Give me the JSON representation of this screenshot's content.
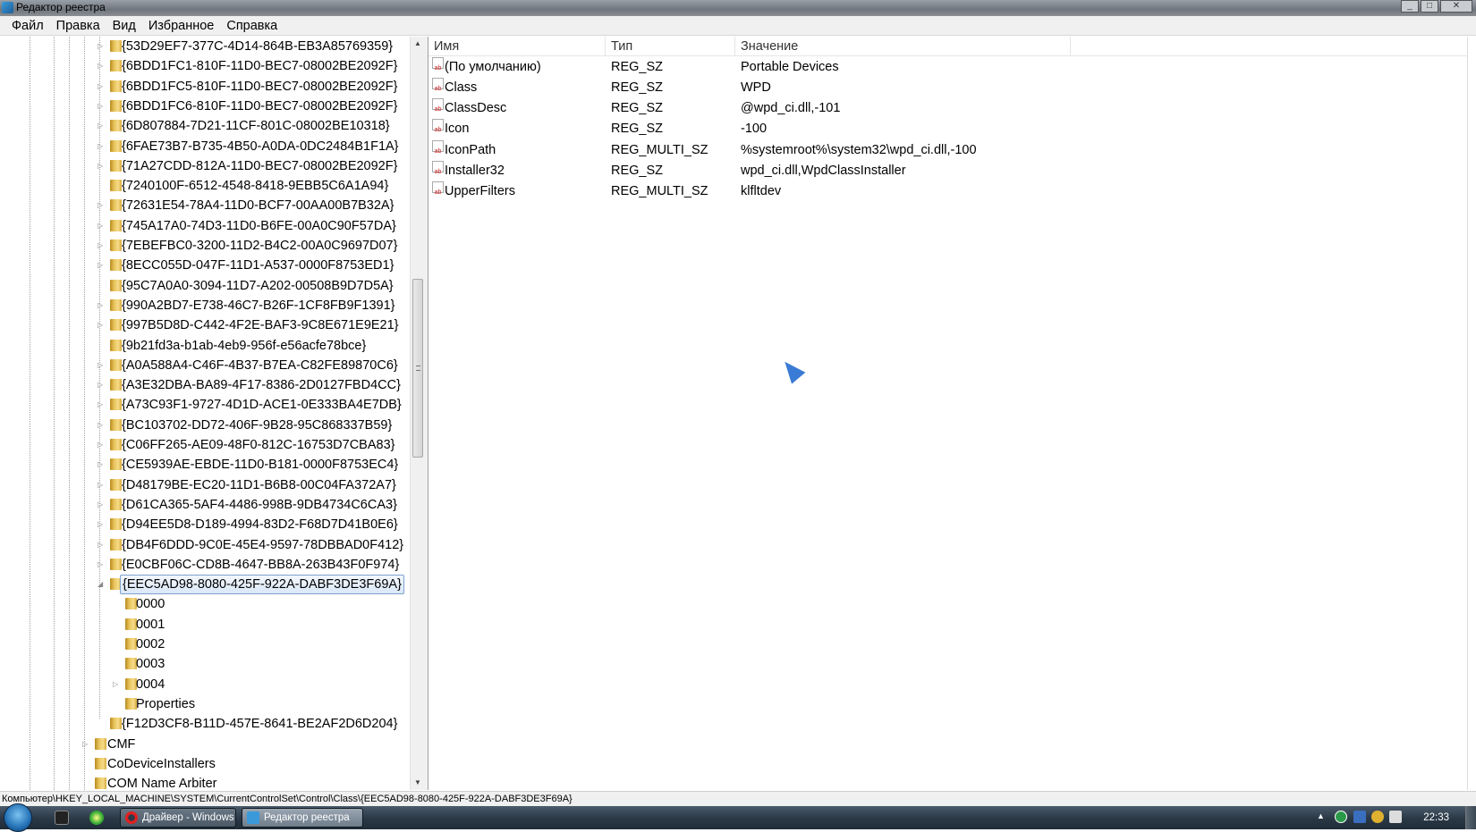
{
  "window": {
    "title": "Редактор реестра"
  },
  "menu": [
    "Файл",
    "Правка",
    "Вид",
    "Избранное",
    "Справка"
  ],
  "tree": [
    {
      "label": "{53D29EF7-377C-4D14-864B-EB3A85769359}",
      "level": 2,
      "expander": "closed"
    },
    {
      "label": "{6BDD1FC1-810F-11D0-BEC7-08002BE2092F}",
      "level": 2,
      "expander": "closed"
    },
    {
      "label": "{6BDD1FC5-810F-11D0-BEC7-08002BE2092F}",
      "level": 2,
      "expander": "closed"
    },
    {
      "label": "{6BDD1FC6-810F-11D0-BEC7-08002BE2092F}",
      "level": 2,
      "expander": "closed"
    },
    {
      "label": "{6D807884-7D21-11CF-801C-08002BE10318}",
      "level": 2,
      "expander": "closed"
    },
    {
      "label": "{6FAE73B7-B735-4B50-A0DA-0DC2484B1F1A}",
      "level": 2,
      "expander": "closed"
    },
    {
      "label": "{71A27CDD-812A-11D0-BEC7-08002BE2092F}",
      "level": 2,
      "expander": "closed"
    },
    {
      "label": "{7240100F-6512-4548-8418-9EBB5C6A1A94}",
      "level": 2,
      "expander": "none"
    },
    {
      "label": "{72631E54-78A4-11D0-BCF7-00AA00B7B32A}",
      "level": 2,
      "expander": "closed"
    },
    {
      "label": "{745A17A0-74D3-11D0-B6FE-00A0C90F57DA}",
      "level": 2,
      "expander": "closed"
    },
    {
      "label": "{7EBEFBC0-3200-11D2-B4C2-00A0C9697D07}",
      "level": 2,
      "expander": "closed"
    },
    {
      "label": "{8ECC055D-047F-11D1-A537-0000F8753ED1}",
      "level": 2,
      "expander": "closed"
    },
    {
      "label": "{95C7A0A0-3094-11D7-A202-00508B9D7D5A}",
      "level": 2,
      "expander": "none"
    },
    {
      "label": "{990A2BD7-E738-46C7-B26F-1CF8FB9F1391}",
      "level": 2,
      "expander": "closed"
    },
    {
      "label": "{997B5D8D-C442-4F2E-BAF3-9C8E671E9E21}",
      "level": 2,
      "expander": "closed"
    },
    {
      "label": "{9b21fd3a-b1ab-4eb9-956f-e56acfe78bce}",
      "level": 2,
      "expander": "none"
    },
    {
      "label": "{A0A588A4-C46F-4B37-B7EA-C82FE89870C6}",
      "level": 2,
      "expander": "closed"
    },
    {
      "label": "{A3E32DBA-BA89-4F17-8386-2D0127FBD4CC}",
      "level": 2,
      "expander": "closed"
    },
    {
      "label": "{A73C93F1-9727-4D1D-ACE1-0E333BA4E7DB}",
      "level": 2,
      "expander": "closed"
    },
    {
      "label": "{BC103702-DD72-406F-9B28-95C868337B59}",
      "level": 2,
      "expander": "closed"
    },
    {
      "label": "{C06FF265-AE09-48F0-812C-16753D7CBA83}",
      "level": 2,
      "expander": "closed"
    },
    {
      "label": "{CE5939AE-EBDE-11D0-B181-0000F8753EC4}",
      "level": 2,
      "expander": "closed"
    },
    {
      "label": "{D48179BE-EC20-11D1-B6B8-00C04FA372A7}",
      "level": 2,
      "expander": "closed"
    },
    {
      "label": "{D61CA365-5AF4-4486-998B-9DB4734C6CA3}",
      "level": 2,
      "expander": "closed"
    },
    {
      "label": "{D94EE5D8-D189-4994-83D2-F68D7D41B0E6}",
      "level": 2,
      "expander": "closed"
    },
    {
      "label": "{DB4F6DDD-9C0E-45E4-9597-78DBBAD0F412}",
      "level": 2,
      "expander": "closed"
    },
    {
      "label": "{E0CBF06C-CD8B-4647-BB8A-263B43F0F974}",
      "level": 2,
      "expander": "closed"
    },
    {
      "label": "{EEC5AD98-8080-425F-922A-DABF3DE3F69A}",
      "level": 2,
      "expander": "open",
      "selected": true
    },
    {
      "label": "0000",
      "level": 3,
      "expander": "none"
    },
    {
      "label": "0001",
      "level": 3,
      "expander": "none"
    },
    {
      "label": "0002",
      "level": 3,
      "expander": "none"
    },
    {
      "label": "0003",
      "level": 3,
      "expander": "none"
    },
    {
      "label": "0004",
      "level": 3,
      "expander": "closed"
    },
    {
      "label": "Properties",
      "level": 3,
      "expander": "none"
    },
    {
      "label": "{F12D3CF8-B11D-457E-8641-BE2AF2D6D204}",
      "level": 2,
      "expander": "none"
    },
    {
      "label": "CMF",
      "level": 1,
      "expander": "closed"
    },
    {
      "label": "CoDeviceInstallers",
      "level": 1,
      "expander": "none"
    },
    {
      "label": "COM Name Arbiter",
      "level": 1,
      "expander": "none"
    }
  ],
  "list": {
    "columns": [
      "Имя",
      "Тип",
      "Значение"
    ],
    "rows": [
      {
        "name": "(По умолчанию)",
        "type": "REG_SZ",
        "value": "Portable Devices"
      },
      {
        "name": "Class",
        "type": "REG_SZ",
        "value": "WPD"
      },
      {
        "name": "ClassDesc",
        "type": "REG_SZ",
        "value": "@wpd_ci.dll,-101"
      },
      {
        "name": "Icon",
        "type": "REG_SZ",
        "value": "-100"
      },
      {
        "name": "IconPath",
        "type": "REG_MULTI_SZ",
        "value": "%systemroot%\\system32\\wpd_ci.dll,-100"
      },
      {
        "name": "Installer32",
        "type": "REG_SZ",
        "value": "wpd_ci.dll,WpdClassInstaller"
      },
      {
        "name": "UpperFilters",
        "type": "REG_MULTI_SZ",
        "value": "klfltdev"
      }
    ],
    "value_icon": "ab"
  },
  "status": {
    "path": "Компьютер\\HKEY_LOCAL_MACHINE\\SYSTEM\\CurrentControlSet\\Control\\Class\\{EEC5AD98-8080-425F-922A-DABF3DE3F69A}"
  },
  "taskbar": {
    "buttons": [
      {
        "label": "Драйвер - Windows ...",
        "icon": "opera-icon",
        "active": false
      },
      {
        "label": "Редактор реестра",
        "icon": "regedit-icon",
        "active": true
      }
    ],
    "clock": "22:33"
  }
}
